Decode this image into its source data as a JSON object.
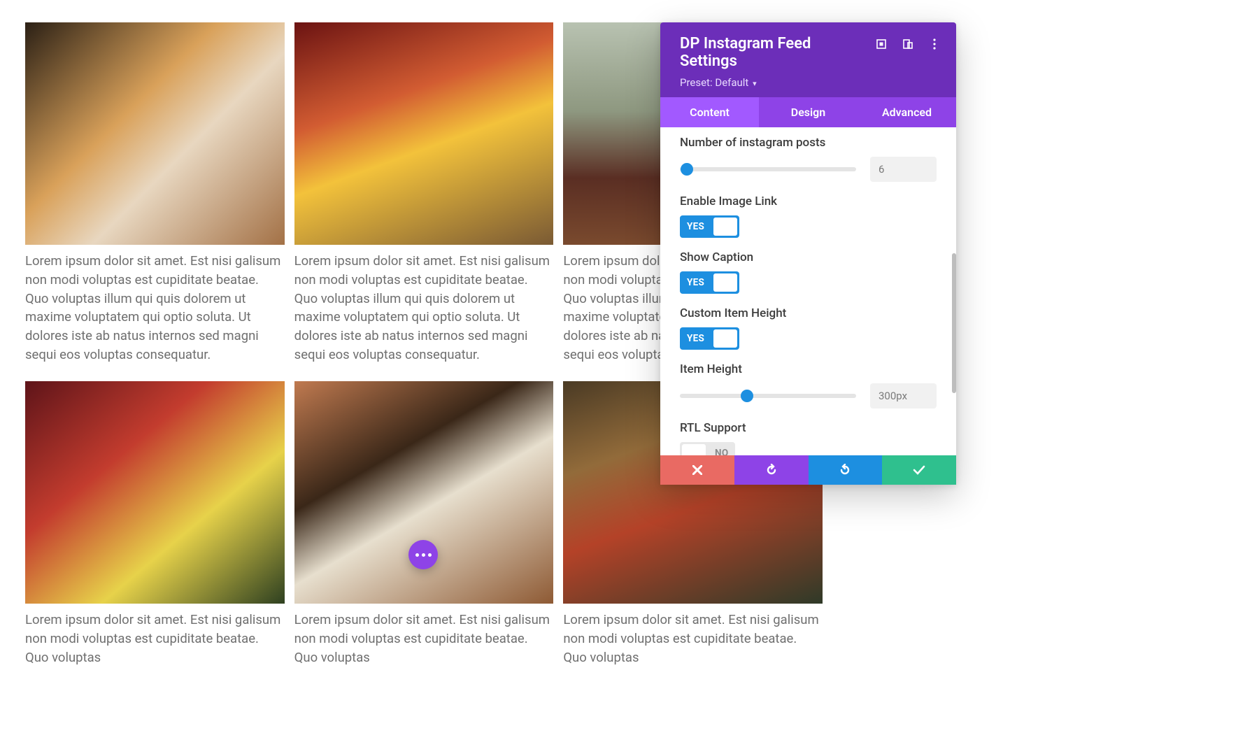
{
  "feed": {
    "caption": "Lorem ipsum dolor sit amet. Est nisi galisum non modi voluptas est cupiditate beatae. Quo voluptas illum qui quis dolorem ut maxime voluptatem qui optio soluta. Ut dolores iste ab natus internos sed magni sequi eos voluptas consequatur.",
    "caption_short": "Lorem ipsum dolor sit amet. Est nisi galisum non modi voluptas est cupiditate beatae. Quo voluptas"
  },
  "panel": {
    "title": "DP Instagram Feed Settings",
    "preset_label": "Preset:",
    "preset_value": "Default",
    "tabs": {
      "content": "Content",
      "design": "Design",
      "advanced": "Advanced"
    }
  },
  "fields": {
    "num_posts": {
      "label": "Number of instagram posts",
      "value": "6",
      "slider_pct": 4
    },
    "enable_link": {
      "label": "Enable Image Link",
      "value": "YES",
      "on": true
    },
    "show_caption": {
      "label": "Show Caption",
      "value": "YES",
      "on": true
    },
    "custom_height": {
      "label": "Custom Item Height",
      "value": "YES",
      "on": true
    },
    "item_height": {
      "label": "Item Height",
      "value": "300px",
      "slider_pct": 38
    },
    "rtl": {
      "label": "RTL Support",
      "value": "NO",
      "on": false
    }
  },
  "actions": {
    "cancel": "cancel",
    "undo": "undo",
    "redo": "redo",
    "save": "save"
  }
}
